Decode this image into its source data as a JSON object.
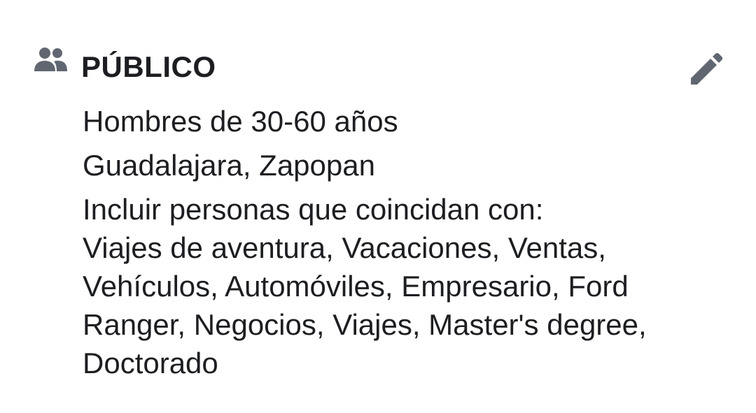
{
  "audience": {
    "title": "PÚBLICO",
    "icon": "people-icon",
    "edit_icon": "pencil-icon",
    "icon_color": "#606770",
    "demographics": "Hombres de 30-60 años",
    "locations": "Guadalajara, Zapopan",
    "interests_intro": "Incluir personas que coincidan con:",
    "interests_lines": [
      "Viajes de aventura, Vacaciones, Ventas,",
      "Vehículos, Automóviles, Empresario, Ford",
      "Ranger, Negocios, Viajes, Master's degree,",
      "Doctorado"
    ]
  }
}
